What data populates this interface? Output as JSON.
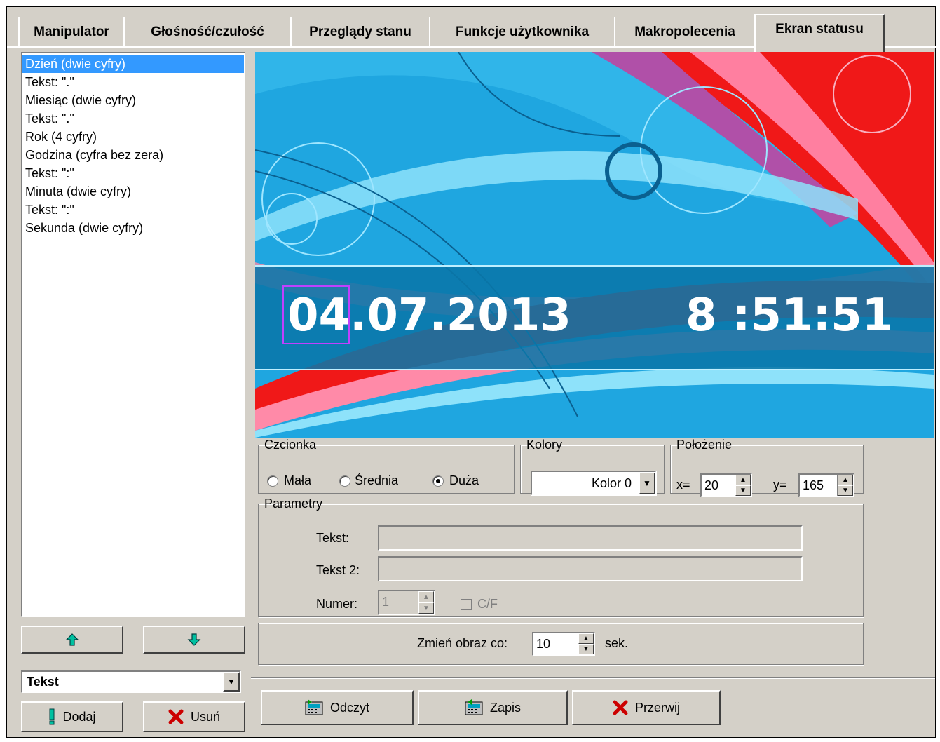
{
  "tabs": [
    {
      "label": "Manipulator"
    },
    {
      "label": "Głośność/czułość"
    },
    {
      "label": "Przeglądy stanu"
    },
    {
      "label": "Funkcje użytkownika"
    },
    {
      "label": "Makropolecenia"
    },
    {
      "label": "Ekran statusu"
    }
  ],
  "element_list": [
    "Dzień (dwie cyfry)",
    "Tekst: \".\"",
    "Miesiąc (dwie cyfry)",
    "Tekst: \".\"",
    "Rok (4 cyfry)",
    "Godzina (cyfra bez zera)",
    "Tekst: \":\"",
    "Minuta (dwie cyfry)",
    "Tekst: \":\"",
    "Sekunda (dwie cyfry)"
  ],
  "preview": {
    "date_day": "04",
    "date_rest": ".07.2013",
    "time": "8 :51:51"
  },
  "type_combo": {
    "value": "Tekst"
  },
  "buttons": {
    "add": "Dodaj",
    "remove": "Usuń",
    "read": "Odczyt",
    "write": "Zapis",
    "stop": "Przerwij"
  },
  "font_group": {
    "legend": "Czcionka",
    "options": [
      "Mała",
      "Średnia",
      "Duża"
    ],
    "selected": "Duża"
  },
  "colors_group": {
    "legend": "Kolory",
    "value": "Kolor 0"
  },
  "position_group": {
    "legend": "Położenie",
    "x_label": "x=",
    "x_value": "20",
    "y_label": "y=",
    "y_value": "165"
  },
  "params_group": {
    "legend": "Parametry",
    "text_label": "Tekst:",
    "text_value": "",
    "text2_label": "Tekst 2:",
    "text2_value": "",
    "number_label": "Numer:",
    "number_value": "1",
    "cf_label": "C/F"
  },
  "interval": {
    "label": "Zmień obraz co:",
    "value": "10",
    "unit": "sek."
  },
  "colors": {
    "selection": "#3399ff",
    "arrow": "#00c0a0",
    "remove_x": "#cc0000",
    "overlay_band": "#0a76a8"
  }
}
